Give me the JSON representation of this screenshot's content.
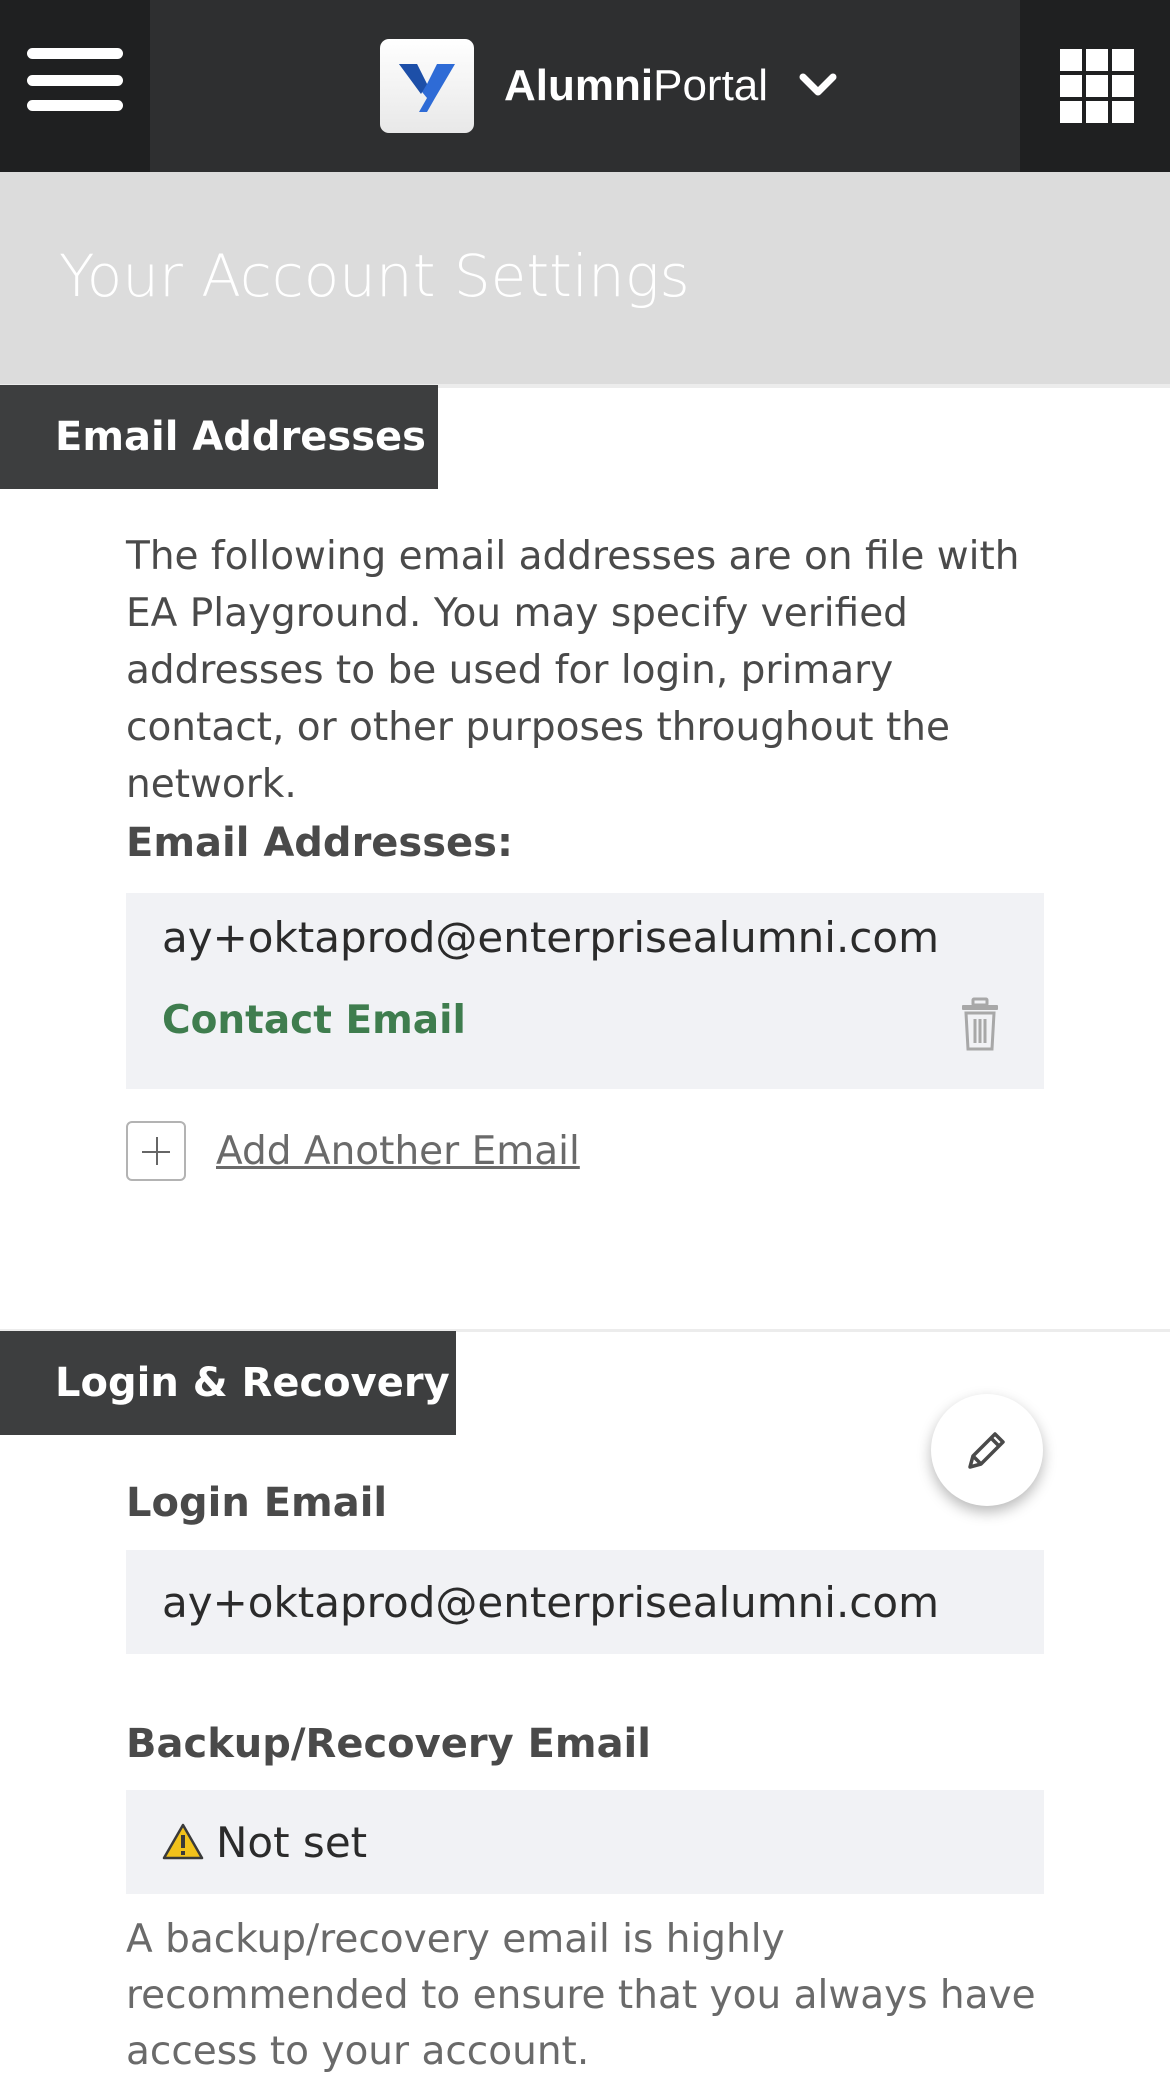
{
  "header": {
    "brand_bold": "Alumni",
    "brand_light": "Portal",
    "logo_letter": "Y"
  },
  "page": {
    "title": "Your Account Settings"
  },
  "email_section": {
    "tab_label": "Email Addresses",
    "description": "The following email addresses are on file with EA Playground. You may specify verified addresses to be used for login, primary contact, or other purposes throughout the network.",
    "field_label": "Email Addresses:",
    "emails": [
      {
        "address": "ay+oktaprod@enterprisealumni.com",
        "tag": "Contact Email"
      }
    ],
    "add_label": "Add Another Email"
  },
  "login_section": {
    "tab_label": "Login & Recovery",
    "login_email_label": "Login Email",
    "login_email_value": "ay+oktaprod@enterprisealumni.com",
    "backup_label": "Backup/Recovery Email",
    "backup_value": "Not set",
    "backup_note": "A backup/recovery email is highly recommended to ensure that you always have access to your account."
  },
  "colors": {
    "topbar": "#2e2f30",
    "banner": "#dcdcdc",
    "section_tab": "#3d3e3f",
    "contact_tag": "#3f7d4e",
    "logo_accent": "#2e6bd6",
    "warning": "#f2c21b"
  },
  "icons": [
    "hamburger-menu-icon",
    "chevron-down-icon",
    "app-grid-icon",
    "trash-icon",
    "plus-icon",
    "pencil-icon",
    "warning-icon"
  ]
}
